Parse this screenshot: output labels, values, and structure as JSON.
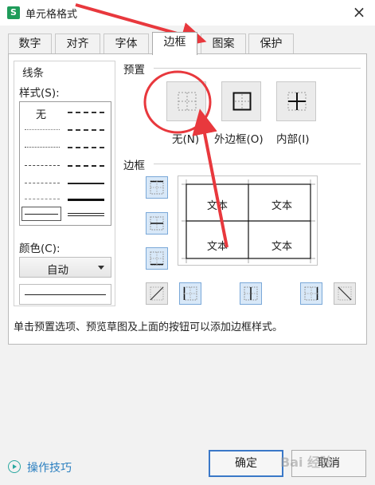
{
  "window": {
    "title": "单元格格式",
    "app_icon_letter": "S",
    "close_glyph": "×"
  },
  "tabs": [
    {
      "label": "数字"
    },
    {
      "label": "对齐"
    },
    {
      "label": "字体"
    },
    {
      "label": "边框",
      "active": true
    },
    {
      "label": "图案"
    },
    {
      "label": "保护"
    }
  ],
  "line": {
    "group_title": "线条",
    "style_label": "样式(S):",
    "none_label": "无",
    "color_label": "颜色(C):",
    "color_value": "自动"
  },
  "preset": {
    "title": "预置",
    "none_label": "无(N)",
    "outline_label": "外边框(O)",
    "inside_label": "内部(I)"
  },
  "border": {
    "title": "边框",
    "preview_cells": [
      "文本",
      "文本",
      "文本",
      "文本"
    ]
  },
  "hint": "单击预置选项、预览草图及上面的按钮可以添加边框样式。",
  "footer": {
    "tips_label": "操作技巧",
    "ok_label": "确定",
    "cancel_label": "取消",
    "watermark": "Bai 经验"
  },
  "colors": {
    "selected_button_border": "#7aa8d8",
    "selected_button_fill": "#d8e8f8",
    "annotation_red": "#e8383d",
    "tips_teal": "#2aa8a0",
    "primary_button_border": "#3a78c8"
  }
}
